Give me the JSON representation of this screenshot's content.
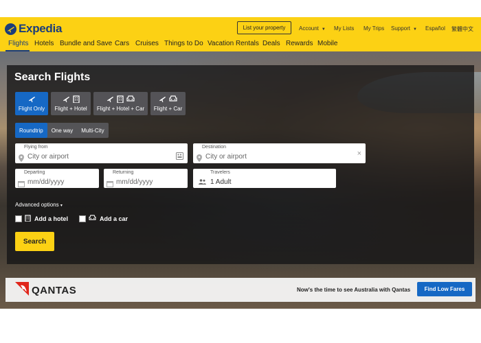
{
  "brand": {
    "name": "Expedia",
    "color": "#1b3d7a",
    "header_bg": "#fcd114"
  },
  "header": {
    "list_property": "List your property",
    "account": "Account",
    "my_lists": "My Lists",
    "my_trips": "My Trips",
    "support": "Support",
    "espanol": "Español",
    "chinese": "繁體中文"
  },
  "nav": [
    "Flights",
    "Hotels",
    "Bundle and Save",
    "Cars",
    "Cruises",
    "Things to Do",
    "Vacation Rentals",
    "Deals",
    "Rewards",
    "Mobile"
  ],
  "search": {
    "title": "Search Flights",
    "product_tabs": [
      "Flight Only",
      "Flight + Hotel",
      "Flight + Hotel + Car",
      "Flight + Car"
    ],
    "trip_types": [
      "Roundtrip",
      "One way",
      "Multi-City"
    ],
    "flying_from": {
      "label": "Flying from",
      "placeholder": "City or airport"
    },
    "destination": {
      "label": "Destination",
      "placeholder": "City or airport"
    },
    "departing": {
      "label": "Departing",
      "placeholder": "mm/dd/yyyy"
    },
    "returning": {
      "label": "Returning",
      "placeholder": "mm/dd/yyyy"
    },
    "travelers": {
      "label": "Travelers",
      "value": "1 Adult"
    },
    "advanced": "Advanced options",
    "add_hotel": "Add a hotel",
    "add_car": "Add a car",
    "search_button": "Search"
  },
  "ad": {
    "brand": "QANTAS",
    "text": "Now's the time to see Australia with Qantas",
    "button": "Find Low Fares"
  }
}
